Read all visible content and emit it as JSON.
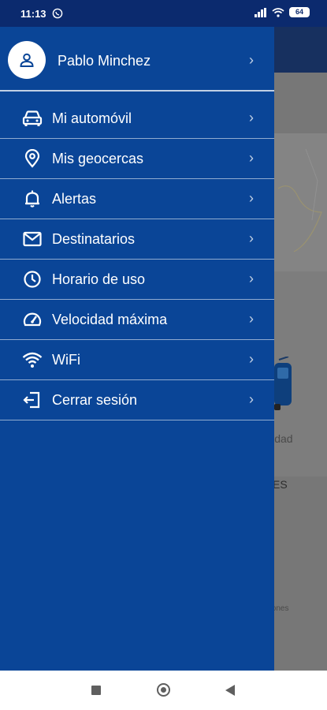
{
  "status_bar": {
    "time": "11:13",
    "battery": "64"
  },
  "profile": {
    "name": "Pablo Minchez"
  },
  "menu": {
    "items": [
      {
        "label": "Mi automóvil",
        "icon": "car-icon"
      },
      {
        "label": "Mis geocercas",
        "icon": "location-pin-icon"
      },
      {
        "label": "Alertas",
        "icon": "bell-icon"
      },
      {
        "label": "Destinatarios",
        "icon": "mail-icon"
      },
      {
        "label": "Horario de uso",
        "icon": "clock-icon"
      },
      {
        "label": "Velocidad máxima",
        "icon": "speedometer-icon"
      },
      {
        "label": "WiFi",
        "icon": "wifi-icon"
      },
      {
        "label": "Cerrar sesión",
        "icon": "logout-icon"
      }
    ],
    "chevron": "›"
  },
  "background": {
    "partial_a": "lidad",
    "partial_b": "ES",
    "partial_c": "aciones"
  },
  "colors": {
    "drawer": "#0a4597",
    "status_bar": "#0b2a6e",
    "app_bar": "#17305f"
  }
}
